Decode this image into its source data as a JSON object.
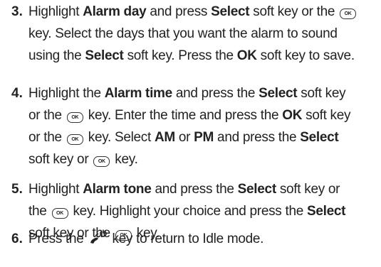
{
  "steps": [
    {
      "number": "3.",
      "lines": [
        [
          {
            "t": "Highlight "
          },
          {
            "t": "Alarm day",
            "b": true
          },
          {
            "t": " and press "
          },
          {
            "t": "Select",
            "b": true
          },
          {
            "t": " soft key or the "
          },
          {
            "k": "ok"
          }
        ],
        [
          {
            "t": "key. Select the days that you want the alarm to sound"
          }
        ],
        [
          {
            "t": "using the "
          },
          {
            "t": "Select",
            "b": true
          },
          {
            "t": " soft key. Press the "
          },
          {
            "t": "OK",
            "b": true
          },
          {
            "t": " soft key to save."
          }
        ]
      ]
    },
    {
      "number": "4.",
      "lines": [
        [
          {
            "t": "Highlight the "
          },
          {
            "t": "Alarm time",
            "b": true
          },
          {
            "t": " and press the "
          },
          {
            "t": "Select",
            "b": true
          },
          {
            "t": " soft key"
          }
        ],
        [
          {
            "t": "or the "
          },
          {
            "k": "ok"
          },
          {
            "t": " key. Enter the time and press the "
          },
          {
            "t": "OK",
            "b": true
          },
          {
            "t": " soft key"
          }
        ],
        [
          {
            "t": "or the "
          },
          {
            "k": "ok"
          },
          {
            "t": " key. Select "
          },
          {
            "t": "AM",
            "b": true
          },
          {
            "t": " or "
          },
          {
            "t": "PM",
            "b": true
          },
          {
            "t": " and press the "
          },
          {
            "t": "Select",
            "b": true
          }
        ],
        [
          {
            "t": "soft key or "
          },
          {
            "k": "ok"
          },
          {
            "t": " key."
          }
        ]
      ]
    },
    {
      "number": "5.",
      "lines": [
        [
          {
            "t": "Highlight "
          },
          {
            "t": "Alarm tone",
            "b": true
          },
          {
            "t": " and press the "
          },
          {
            "t": "Select",
            "b": true
          },
          {
            "t": " soft key or"
          }
        ],
        [
          {
            "t": "the "
          },
          {
            "k": "ok"
          },
          {
            "t": " key. Highlight your choice and press the "
          },
          {
            "t": "Select",
            "b": true
          }
        ],
        [
          {
            "t": "soft key or the "
          },
          {
            "k": "ok"
          },
          {
            "t": " key."
          }
        ]
      ]
    },
    {
      "number": "6.",
      "lines": [
        [
          {
            "t": "Press the "
          },
          {
            "k": "end"
          },
          {
            "t": " key to return to Idle mode."
          }
        ]
      ]
    }
  ],
  "icons": {
    "ok": "ok-key-icon",
    "end": "end-power-key-icon"
  },
  "key_labels": {
    "ok": "OK"
  }
}
